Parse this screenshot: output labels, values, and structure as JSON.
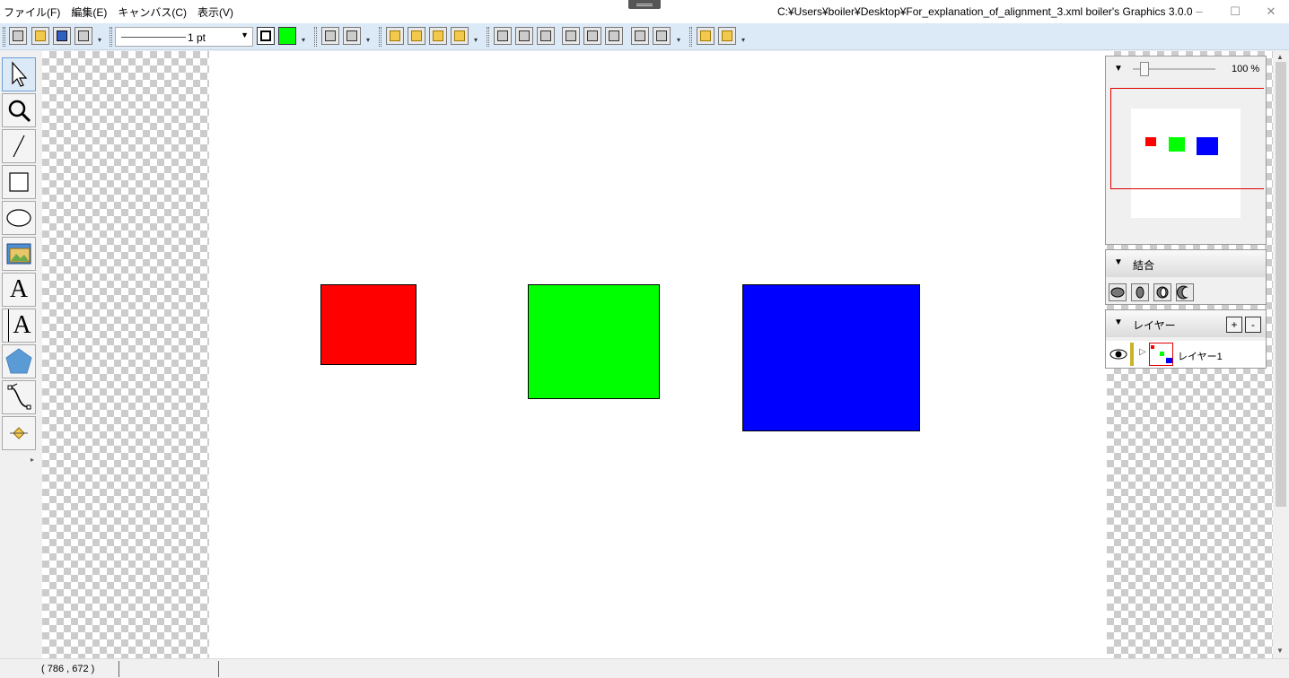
{
  "menu": {
    "items": [
      "ファイル(F)",
      "編集(E)",
      "キャンバス(C)",
      "表示(V)"
    ]
  },
  "window": {
    "title": "C:¥Users¥boiler¥Desktop¥For_explanation_of_alignment_3.xml  boiler's Graphics 3.0.0",
    "minimize": "‒",
    "maximize": "☐",
    "close": "✕"
  },
  "toolbar": {
    "stroke_width": "1 pt",
    "stroke_color": "#000000",
    "fill_color": "#00ff00"
  },
  "tools": [
    {
      "name": "select",
      "icon": "arrow-cursor-icon"
    },
    {
      "name": "zoom",
      "icon": "magnifier-icon"
    },
    {
      "name": "line",
      "icon": "line-icon"
    },
    {
      "name": "rectangle",
      "icon": "rectangle-icon"
    },
    {
      "name": "ellipse",
      "icon": "ellipse-icon"
    },
    {
      "name": "image",
      "icon": "image-icon"
    },
    {
      "name": "text",
      "icon": "text-icon",
      "glyph": "A"
    },
    {
      "name": "text-frame",
      "icon": "text-frame-icon",
      "glyph": "A"
    },
    {
      "name": "polygon",
      "icon": "pentagon-icon"
    },
    {
      "name": "path",
      "icon": "bezier-path-icon"
    },
    {
      "name": "anchor",
      "icon": "anchor-point-icon"
    }
  ],
  "shapes": [
    {
      "name": "red-rectangle",
      "fill": "#ff0000"
    },
    {
      "name": "green-rectangle",
      "fill": "#00ff00"
    },
    {
      "name": "blue-rectangle",
      "fill": "#0000ff"
    }
  ],
  "navigator": {
    "zoom": "100 %"
  },
  "combine": {
    "title": "結合"
  },
  "layers": {
    "title": "レイヤー",
    "add": "+",
    "remove": "-",
    "items": [
      {
        "name": "レイヤー1"
      }
    ]
  },
  "status": {
    "coords": "( 786 ,     672 )"
  }
}
